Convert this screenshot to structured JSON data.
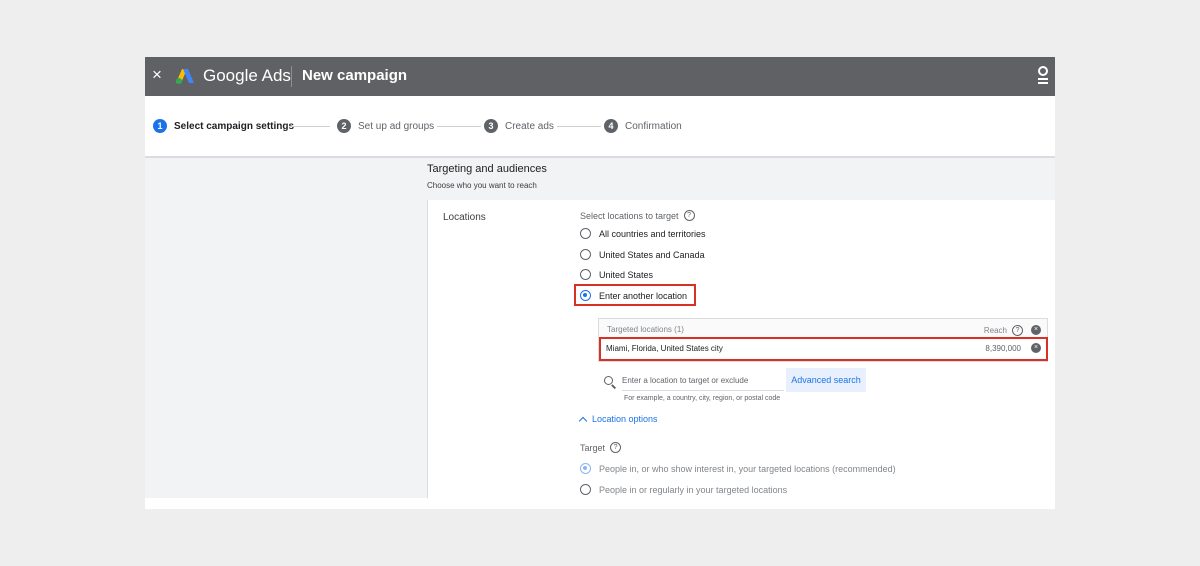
{
  "header": {
    "close_glyph": "×",
    "brand": "Google Ads",
    "title": "New campaign"
  },
  "stepper": {
    "steps": [
      {
        "num": "1",
        "label": "Select campaign settings"
      },
      {
        "num": "2",
        "label": "Set up ad groups"
      },
      {
        "num": "3",
        "label": "Create ads"
      },
      {
        "num": "4",
        "label": "Confirmation"
      }
    ]
  },
  "section": {
    "title": "Targeting and audiences",
    "subtitle": "Choose who you want to reach"
  },
  "locations": {
    "label": "Locations",
    "select_title": "Select locations to target",
    "help_glyph": "?",
    "options": [
      {
        "label": "All countries and territories",
        "checked": false
      },
      {
        "label": "United States and Canada",
        "checked": false
      },
      {
        "label": "United States",
        "checked": false
      },
      {
        "label": "Enter another location",
        "checked": true
      }
    ],
    "targeted_header": "Targeted locations (1)",
    "reach_header": "Reach",
    "row": {
      "name": "Miami, Florida, United States city",
      "reach": "8,390,000"
    },
    "search_placeholder": "Enter a location to target or exclude",
    "advanced_search": "Advanced search",
    "hint": "For example, a country, city, region, or postal code",
    "location_options": "Location options"
  },
  "target": {
    "label": "Target",
    "options": [
      {
        "label": "People in, or who show interest in, your targeted locations (recommended)",
        "checked": true
      },
      {
        "label": "People in or regularly in your targeted locations",
        "checked": false
      }
    ]
  },
  "colors": {
    "header_bg": "#5f6164",
    "accent": "#1a73e8",
    "highlight": "#d93025"
  }
}
